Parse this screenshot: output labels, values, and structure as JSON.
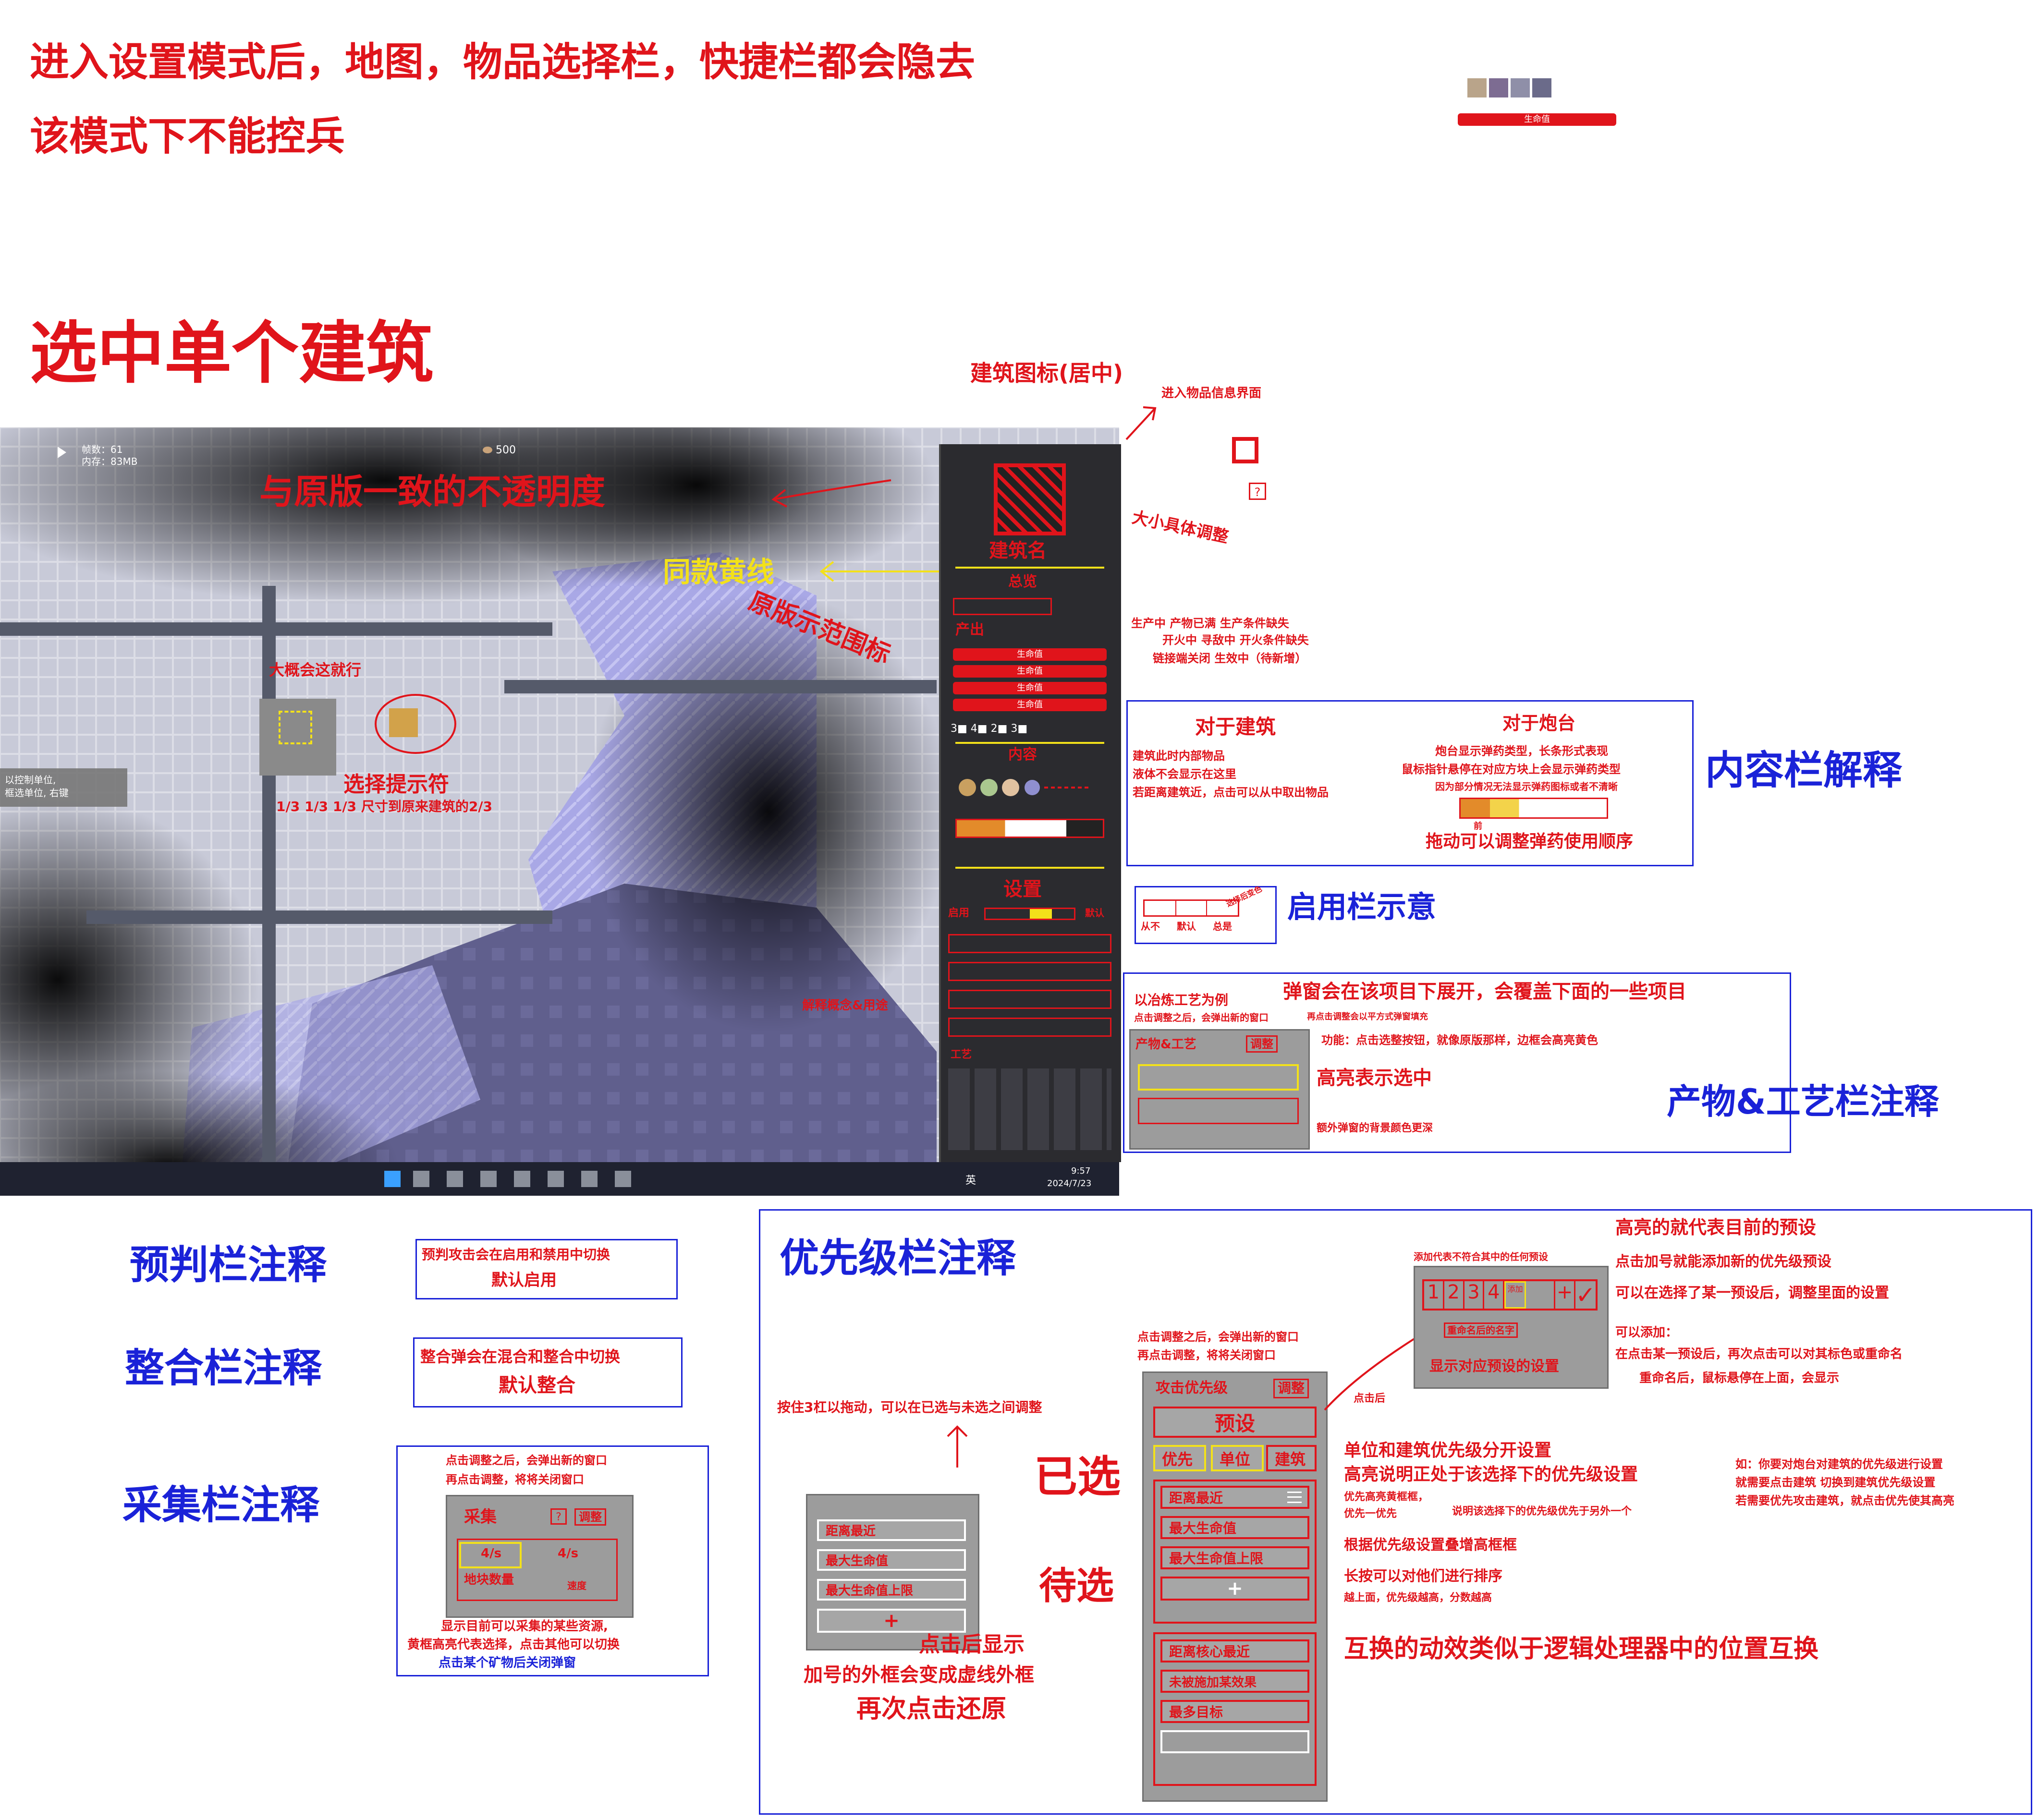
{
  "top_notes": {
    "line1": "进入设置模式后，地图，物品选择栏，快捷栏都会隐去",
    "line2": "该模式下不能控兵",
    "hp_label": "生命值",
    "resource_nums": [
      "3",
      "4",
      "2",
      "3"
    ]
  },
  "section_title": "选中单个建筑",
  "building_annotations": {
    "icon_center": "建筑图标(居中)",
    "enter_page": "进入物品信息界面",
    "size_adjust": "大小具体调整",
    "question": "?",
    "status_line1": "生产中  产物已满  生产条件缺失",
    "status_line2": "开火中  寻敌中  开火条件缺失",
    "status_line3": "链接端关闭  生效中（待新增）"
  },
  "game": {
    "fps": "帧数：61",
    "memory": "内存：83MB",
    "coins": "500",
    "opacity_note": "与原版一致的不透明度",
    "yellow_line_note": "同款黄线",
    "range_note": "原版示范围标",
    "exec_note": "大概会这就行",
    "select_hint": "选择提示符",
    "fraction_note": "1/3 1/3 1/3  尺寸到原来建筑的2/3",
    "control_tip1": "以控制单位,",
    "control_tip2": "框选单位, 右键",
    "expand_note": "解释概念&用途",
    "building_name": "建筑名",
    "health": "生命值",
    "overview": "总览",
    "output_label": "产出",
    "content_label": "内容",
    "settings_label": "设置",
    "enable_label": "启用",
    "defaults_label": "默认",
    "process_label": "工艺",
    "adjust": "调整",
    "taskbar_lang": "英",
    "taskbar_time": "9:57",
    "taskbar_date": "2024/7/23"
  },
  "content_panel": {
    "title_building": "对于建筑",
    "building_lines": [
      "建筑此时内部物品",
      "液体不会显示在这里",
      "若距离建筑近，点击可以从中取出物品"
    ],
    "title_turret": "对于炮台",
    "turret_lines": [
      "炮台显示弹药类型，长条形式表现",
      "鼠标指针悬停在对应方块上会显示弹药类型",
      "因为部分情况无法显示弹药图标或者不清晰"
    ],
    "drag_note": "拖动可以调整弹药使用顺序",
    "drag_small": "前",
    "title": "内容栏解释"
  },
  "enable_panel": {
    "labels": [
      "从不",
      "默认",
      "总是"
    ],
    "side": "选择后变色",
    "title": "启用栏示意"
  },
  "process_panel": {
    "example": "以冶炼工艺为例",
    "click_note": "点击调整之后，会弹出新的窗口",
    "click_note2": "再点击调整，将将关闭窗口",
    "click_note3": "再点击调整会以平方式弹窗填充",
    "popup_note": "弹窗会在该项目下展开，会覆盖下面的一些项目",
    "click_desc": "功能：点击选整按钮，就像原版那样，边框会高亮黄色",
    "highlight": "高亮表示选中",
    "panel_title": "产物&工艺",
    "adjust": "调整",
    "bg_note": "额外弹窗的背景颜色更深",
    "title": "产物&工艺栏注释"
  },
  "left_notes": {
    "predict_title": "预判栏注释",
    "predict_text1": "预判攻击会在启用和禁用中切换",
    "predict_text2": "默认启用",
    "integrate_title": "整合栏注释",
    "integrate_text1": "整合弹会在混合和整合中切换",
    "integrate_text2": "默认整合",
    "collect_title": "采集栏注释",
    "collect_click1": "点击调整之后，会弹出新的窗口",
    "collect_click2": "再点击调整，将将关闭窗口",
    "collect_panel_title": "采集",
    "collect_rate1": "4/s",
    "collect_rate2": "4/s",
    "collect_mine": "地块数量",
    "collect_speed": "速度",
    "collect_desc1": "显示目前可以采集的某些资源,",
    "collect_desc2": "黄框高亮代表选择，点击其他可以切换",
    "collect_desc3": "点击某个矿物后关闭弹窗",
    "question": "?",
    "adjust": "调整"
  },
  "priority": {
    "title": "优先级栏注释",
    "drag_note": "按住3杠以拖动，可以在已选与未选之间调整",
    "chosen": "已选",
    "pending": "待选",
    "left_rows": [
      "距离最近",
      "最大生命值",
      "最大生命值上限"
    ],
    "plus": "+",
    "click_show1": "点击后显示",
    "click_show2": "加号的外框会变成虚线外框",
    "click_show3": "再次点击还原",
    "click_adjust1": "点击调整之后，会弹出新的窗口",
    "click_adjust2": "再点击调整，将将关闭窗口",
    "panel_header": "攻击优先级",
    "adjust": "调整",
    "preset": "预设",
    "tabs": [
      "优先",
      "单位",
      "建筑"
    ],
    "chosen_rows": [
      "距离最近",
      "最大生命值",
      "最大生命值上限"
    ],
    "pending_rows": [
      "距离核心最近",
      "未被施加某效果",
      "最多目标"
    ],
    "click_after": "点击后",
    "popup_hint": "添加代表不符合其中的任何预设",
    "preset_nums": [
      "1",
      "2",
      "3",
      "4"
    ],
    "preset_add": "添加",
    "rename": "重命名后的名字",
    "show_settings": "显示对应预设的设置",
    "hl_note": "高亮的就代表目前的预设",
    "add_note": "点击加号就能添加新的优先级预设",
    "adjust_note": "可以在选择了某一预设后，调整里面的设置",
    "can_add": "可以添加：",
    "rename_note1": "在点击某一预设后，再次点击可以对其标色或重命名",
    "rename_note2": "重命名后，鼠标悬停在上面，会显示",
    "sep_note": "单位和建筑优先级分开设置",
    "hl_note2": "高亮说明正处于该选择下的优先级设置",
    "first_hl": "优先高亮黄框框，",
    "first_note": "优先一优先",
    "explain_first": "说明该选择下的优先级优先于另外一个",
    "border_note": "根据优先级设置叠增高框框",
    "long_press": "长按可以对他们进行排序",
    "order_note": "越上面，优先级越高，分数越高",
    "swap_note": "互换的动效类似于逻辑处理器中的位置互换",
    "example1": "如：你要对炮台对建筑的优先级进行设置",
    "example2": "就需要点击建筑  切换到建筑优先级设置",
    "example3": "若需要优先攻击建筑，就点击优先使其高亮"
  },
  "colors": {
    "annotation_red": "#e0141b",
    "annotation_blue": "#1a22d8",
    "highlight_yellow": "#f3e11a",
    "panel_gray": "#9c9c9c"
  }
}
